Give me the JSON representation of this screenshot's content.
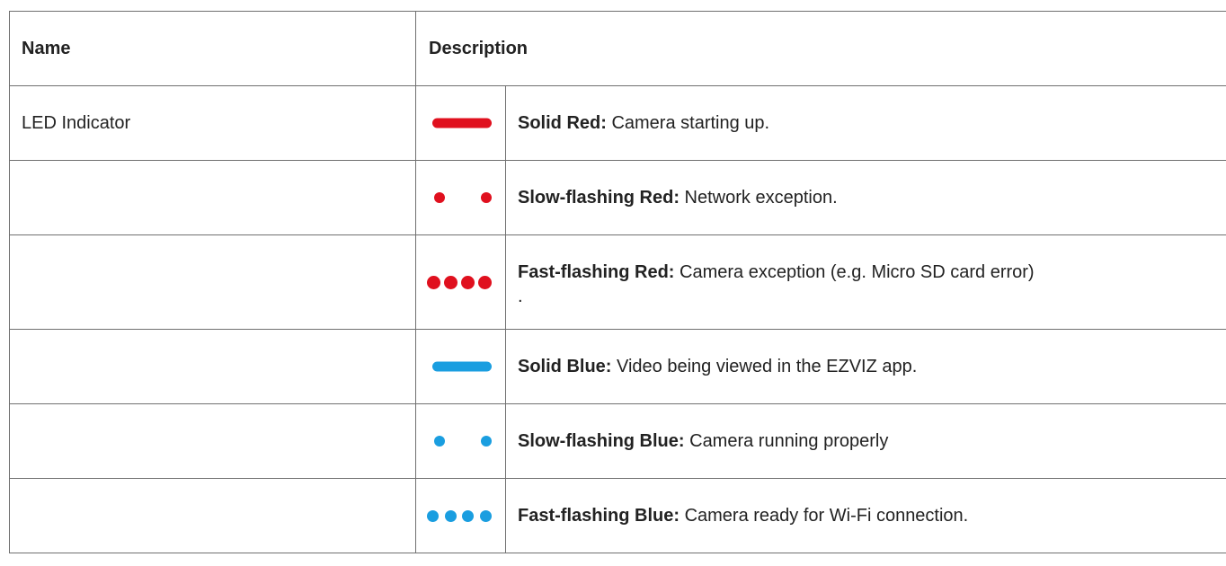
{
  "colors": {
    "red": "#e0101e",
    "blue": "#1a9ee0",
    "border": "#707070"
  },
  "table": {
    "headers": {
      "name": "Name",
      "description": "Description"
    },
    "rows": [
      {
        "name": "LED Indicator",
        "icon": "solid-red-led-icon",
        "label": "Solid Red:",
        "text": " Camera starting up."
      },
      {
        "name": "",
        "icon": "slow-flashing-red-led-icon",
        "label": "Slow-flashing Red:",
        "text": " Network exception."
      },
      {
        "name": "",
        "icon": "fast-flashing-red-led-icon",
        "label": "Fast-flashing Red:",
        "text": " Camera exception (e.g. Micro SD card error)",
        "continuation": "."
      },
      {
        "name": "",
        "icon": "solid-blue-led-icon",
        "label": "Solid Blue:",
        "text": " Video being viewed in the EZVIZ app."
      },
      {
        "name": "",
        "icon": "slow-flashing-blue-led-icon",
        "label": "Slow-flashing Blue:",
        "text": " Camera running properly"
      },
      {
        "name": "",
        "icon": "fast-flashing-blue-led-icon",
        "label": "Fast-flashing Blue:",
        "text": " Camera ready for Wi-Fi connection."
      }
    ]
  }
}
